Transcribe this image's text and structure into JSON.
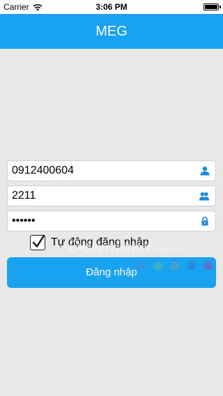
{
  "status_bar": {
    "carrier": "Carrier",
    "time": "3:06 PM",
    "wifi_icon": "wifi-icon",
    "battery_icon": "battery-icon"
  },
  "header": {
    "title": "MEG"
  },
  "form": {
    "phone": {
      "value": "0912400604",
      "icon": "user-icon"
    },
    "account": {
      "value": "2211",
      "icon": "users-icon"
    },
    "password": {
      "value": "123456",
      "icon": "lock-icon"
    },
    "auto_login": {
      "label": "Tự động đăng nhập",
      "checked": true
    },
    "login_label": "Đăng nhập"
  },
  "watermark": {
    "text": "Download",
    "suffix": ".com.vn"
  },
  "colors": {
    "accent": "#19a2f0",
    "background": "#e8e8e8"
  }
}
